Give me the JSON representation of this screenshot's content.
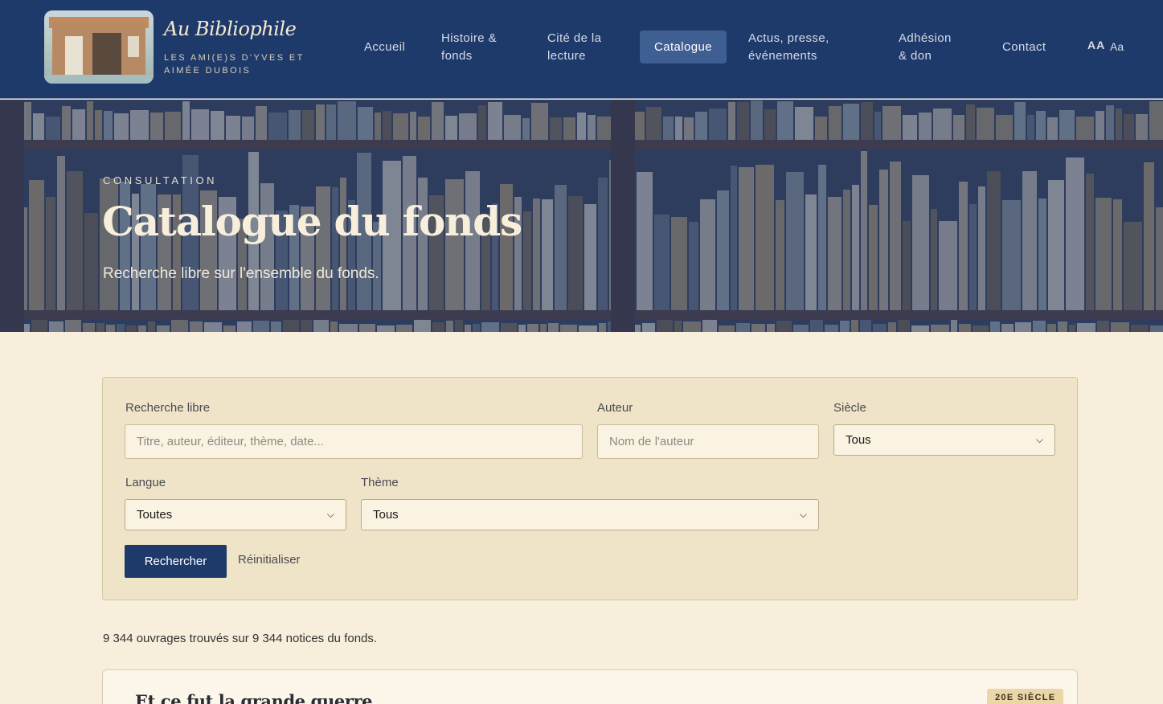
{
  "brand": {
    "title": "Au Bibliophile",
    "subtitle": "LES AMI(E)S D'YVES ET AIMÉE DUBOIS"
  },
  "nav": {
    "items": [
      {
        "label": "Accueil"
      },
      {
        "label": "Histoire & fonds"
      },
      {
        "label": "Cité de la lecture"
      },
      {
        "label": "Catalogue",
        "active": true
      },
      {
        "label": "Actus, presse, événements"
      },
      {
        "label": "Adhésion & don"
      },
      {
        "label": "Contact"
      }
    ],
    "font_toggle": {
      "large": "AA",
      "small": "Aa"
    }
  },
  "hero": {
    "eyebrow": "CONSULTATION",
    "title": "Catalogue du fonds",
    "subtitle": "Recherche libre sur l'ensemble du fonds."
  },
  "search": {
    "free_label": "Recherche libre",
    "free_placeholder": "Titre, auteur, éditeur, thème, date...",
    "author_label": "Auteur",
    "author_placeholder": "Nom de l'auteur",
    "century_label": "Siècle",
    "century_value": "Tous",
    "language_label": "Langue",
    "language_value": "Toutes",
    "theme_label": "Thème",
    "theme_value": "Tous",
    "submit_label": "Rechercher",
    "reset_label": "Réinitialiser"
  },
  "results": {
    "count_text": "9 344 ouvrages trouvés sur 9 344 notices du fonds.",
    "items": [
      {
        "title": "Et ce fut la grande guerre",
        "badge": "20E SIÈCLE"
      }
    ]
  },
  "colors": {
    "header_bg": "#1e3a6b",
    "nav_active_bg": "#3f5e92",
    "page_bg": "#f7efdc",
    "panel_bg": "#f0e4c8",
    "button_bg": "#1e3a6b",
    "badge_bg": "#ead6a6"
  }
}
